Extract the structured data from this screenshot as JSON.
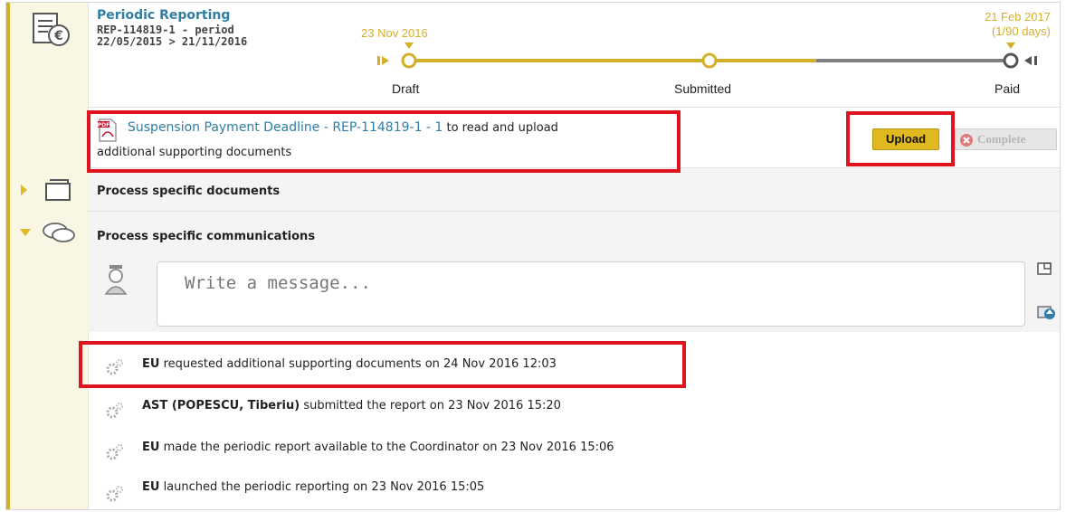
{
  "header": {
    "title": "Periodic Reporting",
    "ref_line": "REP-114819-1 - period",
    "period_line": "22/05/2015 > 21/11/2016"
  },
  "timeline": {
    "start_date": "23 Nov 2016",
    "end_date": "21 Feb 2017",
    "end_days": "(1/90 days)",
    "steps": [
      "Draft",
      "Submitted",
      "Paid"
    ],
    "accent": "#d4b02a",
    "pending_color": "#808080"
  },
  "task": {
    "link_text": "Suspension Payment Deadline - REP-114819-1 - 1",
    "suffix": " to read and upload",
    "second_line": "additional supporting documents",
    "upload_label": "Upload",
    "complete_label": "Complete",
    "pdf_icon": "pdf-icon"
  },
  "sections": {
    "documents": "Process specific documents",
    "communications": "Process specific communications"
  },
  "composer": {
    "placeholder": "Write a message..."
  },
  "activities": [
    {
      "actor": "EU",
      "text": " requested additional supporting documents on 24 Nov 2016 12:03"
    },
    {
      "actor": "AST (POPESCU, Tiberiu)",
      "text": " submitted the report on 23 Nov 2016 15:20"
    },
    {
      "actor": "EU",
      "text": " made the periodic report available to the Coordinator on 23 Nov 2016 15:06"
    },
    {
      "actor": "EU",
      "text": " launched the periodic reporting on 23 Nov 2016 15:05"
    }
  ],
  "colors": {
    "link": "#2e7ea6",
    "highlight": "#e0141f",
    "upload_bg": "#e0b81f"
  }
}
